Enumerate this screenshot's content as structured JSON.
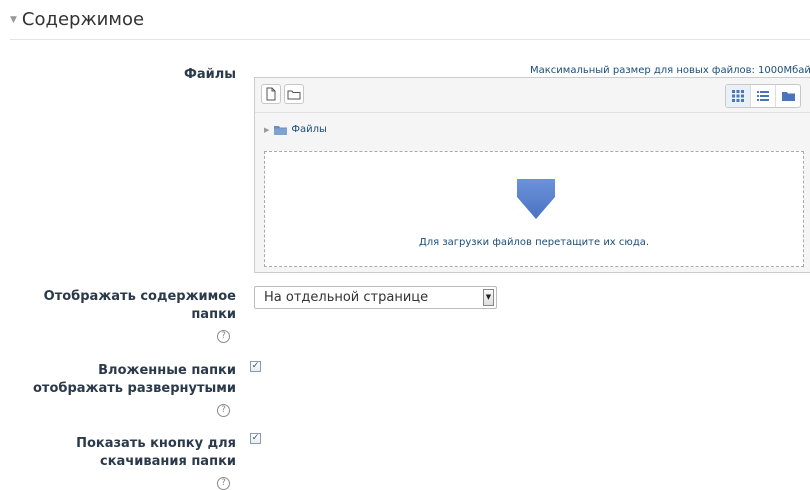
{
  "section": {
    "toggle_icon": "triangle-down-icon",
    "title": "Содержимое"
  },
  "files": {
    "label": "Файлы",
    "max_size_text": "Максимальный размер для новых файлов: 1000Мбайт",
    "toolbar_icons": [
      "add-file-icon",
      "create-folder-icon"
    ],
    "view_icons": [
      "grid-view-icon",
      "list-view-icon",
      "tree-view-icon"
    ],
    "path_folder": "Файлы",
    "drop_text": "Для загрузки файлов перетащите их сюда.",
    "accent_color": "#5b85d2"
  },
  "display_mode": {
    "label_line1": "Отображать содержимое",
    "label_line2": "папки",
    "selected": "На отдельной странице",
    "help_icon": "help-icon"
  },
  "expand_subfolders": {
    "label_line1": "Вложенные папки",
    "label_line2": "отображать развернутыми",
    "checked": true,
    "help_icon": "help-icon"
  },
  "download_button": {
    "label_line1": "Показать кнопку для",
    "label_line2": "скачивания папки",
    "checked": true,
    "help_icon": "help-icon"
  }
}
